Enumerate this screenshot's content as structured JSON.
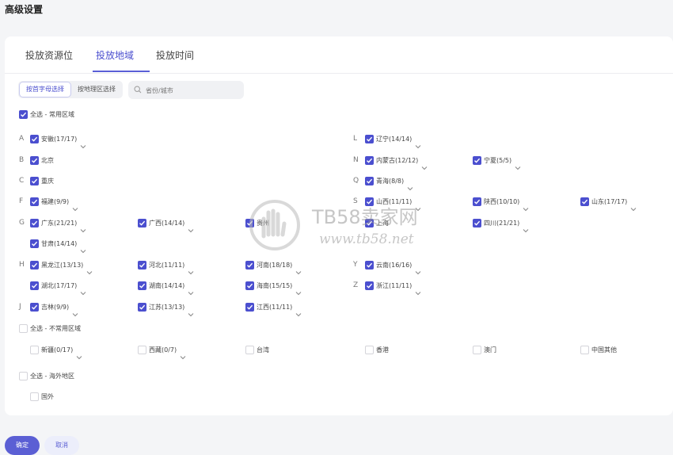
{
  "page_title": "高级设置",
  "tabs": [
    {
      "label": "投放资源位",
      "active": false
    },
    {
      "label": "投放地域",
      "active": true
    },
    {
      "label": "投放时间",
      "active": false
    }
  ],
  "selection_mode": {
    "options": [
      "按首字母选择",
      "按地理区选择"
    ],
    "selected": "按首字母选择"
  },
  "search": {
    "placeholder": "省份/城市"
  },
  "common_regions": {
    "select_all_label": "全选 - 常用区域",
    "select_all_checked": true,
    "letter_rows": [
      {
        "letter": "A",
        "items": [
          {
            "label": "安徽(17/17)",
            "checked": true,
            "has_dropdown": true
          }
        ]
      },
      {
        "letter": "B",
        "items": [
          {
            "label": "北京",
            "checked": true,
            "has_dropdown": false
          }
        ]
      },
      {
        "letter": "C",
        "items": [
          {
            "label": "重庆",
            "checked": true,
            "has_dropdown": false
          }
        ]
      },
      {
        "letter": "F",
        "items": [
          {
            "label": "福建(9/9)",
            "checked": true,
            "has_dropdown": true
          }
        ]
      },
      {
        "letter": "G",
        "items": [
          {
            "label": "广东(21/21)",
            "checked": true,
            "has_dropdown": true
          },
          {
            "label": "广西(14/14)",
            "checked": true,
            "has_dropdown": true
          },
          {
            "label": "贵州",
            "checked": true,
            "has_dropdown": false
          },
          {
            "label": "甘肃(14/14)",
            "checked": true,
            "has_dropdown": true
          }
        ]
      },
      {
        "letter": "H",
        "items": [
          {
            "label": "黑龙江(13/13)",
            "checked": true,
            "has_dropdown": true
          },
          {
            "label": "河北(11/11)",
            "checked": true,
            "has_dropdown": true
          },
          {
            "label": "河南(18/18)",
            "checked": true,
            "has_dropdown": true
          },
          {
            "label": "湖北(17/17)",
            "checked": true,
            "has_dropdown": true
          },
          {
            "label": "湖南(14/14)",
            "checked": true,
            "has_dropdown": true
          },
          {
            "label": "海南(15/15)",
            "checked": true,
            "has_dropdown": true
          }
        ]
      },
      {
        "letter": "J",
        "items": [
          {
            "label": "吉林(9/9)",
            "checked": true,
            "has_dropdown": true
          },
          {
            "label": "江苏(13/13)",
            "checked": true,
            "has_dropdown": true
          },
          {
            "label": "江西(11/11)",
            "checked": true,
            "has_dropdown": true
          }
        ]
      },
      {
        "letter": "L",
        "items": [
          {
            "label": "辽宁(14/14)",
            "checked": true,
            "has_dropdown": true
          }
        ]
      },
      {
        "letter": "N",
        "items": [
          {
            "label": "内蒙古(12/12)",
            "checked": true,
            "has_dropdown": true
          },
          {
            "label": "宁夏(5/5)",
            "checked": true,
            "has_dropdown": true
          }
        ]
      },
      {
        "letter": "Q",
        "items": [
          {
            "label": "青海(8/8)",
            "checked": true,
            "has_dropdown": true
          }
        ]
      },
      {
        "letter": "S",
        "items": [
          {
            "label": "山西(11/11)",
            "checked": true,
            "has_dropdown": true
          },
          {
            "label": "陕西(10/10)",
            "checked": true,
            "has_dropdown": true
          },
          {
            "label": "山东(17/17)",
            "checked": true,
            "has_dropdown": true
          },
          {
            "label": "上海",
            "checked": true,
            "has_dropdown": false
          },
          {
            "label": "四川(21/21)",
            "checked": true,
            "has_dropdown": true
          }
        ]
      },
      {
        "letter": "Y",
        "items": [
          {
            "label": "云南(16/16)",
            "checked": true,
            "has_dropdown": true
          }
        ]
      },
      {
        "letter": "Z",
        "items": [
          {
            "label": "浙江(11/11)",
            "checked": true,
            "has_dropdown": true
          }
        ]
      }
    ]
  },
  "uncommon_regions": {
    "select_all_label": "全选 - 不常用区域",
    "select_all_checked": false,
    "items": [
      {
        "label": "新疆(0/17)",
        "checked": false,
        "has_dropdown": true
      },
      {
        "label": "西藏(0/7)",
        "checked": false,
        "has_dropdown": true
      },
      {
        "label": "台湾",
        "checked": false,
        "has_dropdown": false
      },
      {
        "label": "香港",
        "checked": false,
        "has_dropdown": false
      },
      {
        "label": "澳门",
        "checked": false,
        "has_dropdown": false
      },
      {
        "label": "中国其他",
        "checked": false,
        "has_dropdown": false
      }
    ]
  },
  "overseas_regions": {
    "select_all_label": "全选 - 海外地区",
    "select_all_checked": false,
    "items": [
      {
        "label": "国外",
        "checked": false,
        "has_dropdown": false
      }
    ]
  },
  "footer": {
    "confirm_label": "确定",
    "cancel_label": "取消"
  },
  "watermark": {
    "text": "TB58卖家网",
    "url_text": "www.tb58.net"
  },
  "colors": {
    "accent": "#4b4fcf",
    "primary_button": "#5b5fd4",
    "page_background": "#f4f5f7"
  }
}
